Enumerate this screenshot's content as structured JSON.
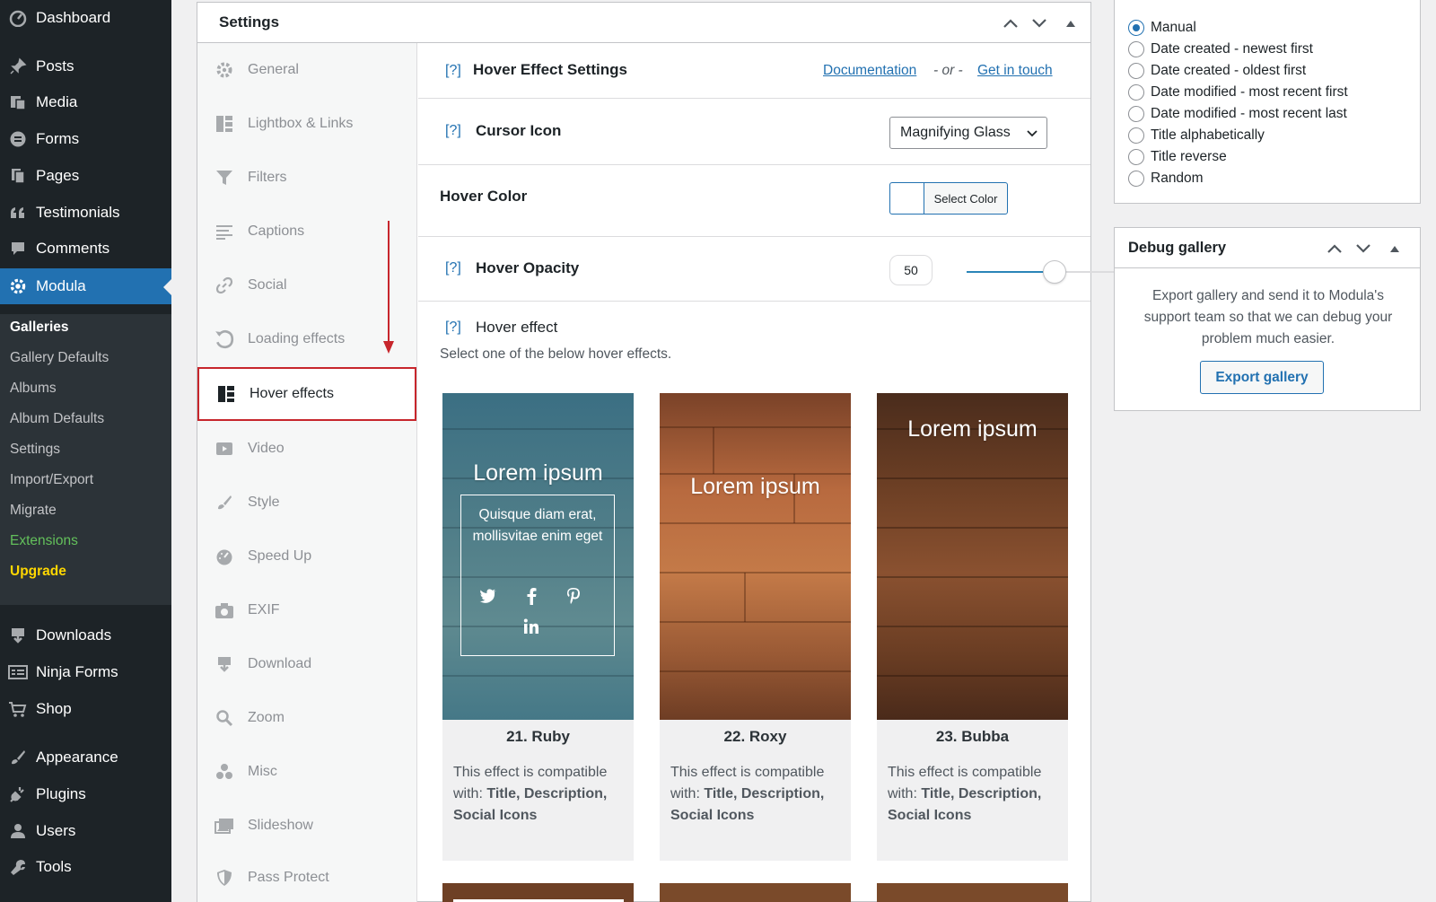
{
  "admin_menu": {
    "items_top": [
      {
        "label": "Dashboard",
        "icon": "dashboard-icon"
      },
      {
        "label": "Posts",
        "icon": "pin-icon"
      },
      {
        "label": "Media",
        "icon": "media-icon"
      },
      {
        "label": "Forms",
        "icon": "forms-icon"
      },
      {
        "label": "Pages",
        "icon": "pages-icon"
      },
      {
        "label": "Testimonials",
        "icon": "quote-icon"
      },
      {
        "label": "Comments",
        "icon": "comment-icon"
      },
      {
        "label": "Modula",
        "icon": "gear-icon"
      }
    ],
    "submenu": [
      "Galleries",
      "Gallery Defaults",
      "Albums",
      "Album Defaults",
      "Settings",
      "Import/Export",
      "Migrate",
      "Extensions",
      "Upgrade"
    ],
    "items_bottom": [
      {
        "label": "Downloads",
        "icon": "download-icon"
      },
      {
        "label": "Ninja Forms",
        "icon": "form-icon"
      },
      {
        "label": "Shop",
        "icon": "cart-icon"
      },
      {
        "label": "Appearance",
        "icon": "brush-icon"
      },
      {
        "label": "Plugins",
        "icon": "plug-icon"
      },
      {
        "label": "Users",
        "icon": "user-icon"
      },
      {
        "label": "Tools",
        "icon": "wrench-icon"
      }
    ]
  },
  "settings": {
    "title": "Settings",
    "tabs": [
      "General",
      "Lightbox & Links",
      "Filters",
      "Captions",
      "Social",
      "Loading effects",
      "Hover effects",
      "Video",
      "Style",
      "Speed Up",
      "EXIF",
      "Download",
      "Zoom",
      "Misc",
      "Slideshow",
      "Pass Protect"
    ],
    "active_tab": "Hover effects"
  },
  "content": {
    "help": "[?]",
    "section_title": "Hover Effect Settings",
    "doc_link": "Documentation",
    "or_text": "- or -",
    "contact_link": "Get in touch",
    "cursor_label": "Cursor Icon",
    "cursor_value": "Magnifying Glass",
    "hover_color_label": "Hover Color",
    "select_color": "Select Color",
    "hover_color_value": "#ffffff",
    "opacity_label": "Hover Opacity",
    "opacity_value": "50",
    "opacity_fraction": 0.5,
    "effect_label": "Hover effect",
    "effect_hint": "Select one of the below hover effects.",
    "cards": [
      {
        "name": "21. Ruby",
        "img_title": "Lorem ipsum",
        "img_text": "Quisque diam erat, mollisvitae enim eget",
        "desc_prefix": "This effect is compatible with:",
        "desc_bold": "Title, Description, Social Icons"
      },
      {
        "name": "22. Roxy",
        "img_title": "Lorem ipsum",
        "desc_prefix": "This effect is compatible with:",
        "desc_bold": "Title, Description, Social Icons"
      },
      {
        "name": "23. Bubba",
        "img_title": "Lorem ipsum",
        "desc_prefix": "This effect is compatible with:",
        "desc_bold": "Title, Description, Social Icons"
      }
    ]
  },
  "sort": {
    "options": [
      "Manual",
      "Date created - newest first",
      "Date created - oldest first",
      "Date modified - most recent first",
      "Date modified - most recent last",
      "Title alphabetically",
      "Title reverse",
      "Random"
    ],
    "selected": "Manual"
  },
  "debug": {
    "title": "Debug gallery",
    "text": "Export gallery and send it to Modula's support team so that we can debug your problem much easier.",
    "button": "Export gallery"
  },
  "colors": {
    "accent": "#2271b1",
    "sidebar": "#1d2327",
    "highlight_border": "#c7262c"
  }
}
